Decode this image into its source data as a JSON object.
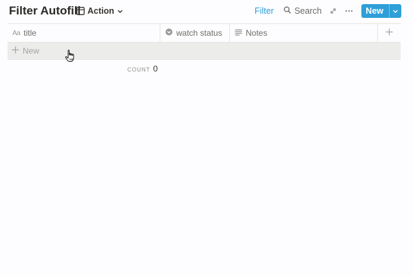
{
  "header": {
    "title": "Filter Autofill",
    "view": {
      "icon": "table-icon",
      "label": "Action"
    }
  },
  "toolbar": {
    "filter_label": "Filter",
    "search_label": "Search",
    "expand_icon": "expand-icon",
    "more_icon": "more-icon",
    "new_label": "New"
  },
  "table": {
    "columns": [
      {
        "icon": "text-type-icon",
        "label": "title"
      },
      {
        "icon": "select-type-icon",
        "label": "watch status"
      },
      {
        "icon": "lines-type-icon",
        "label": "Notes"
      }
    ],
    "new_row_label": "New",
    "count_label": "COUNT",
    "count_value": "0"
  },
  "colors": {
    "accent": "#2e9fd8",
    "background": "#fdfcfe",
    "row_hover": "#ececeb"
  }
}
